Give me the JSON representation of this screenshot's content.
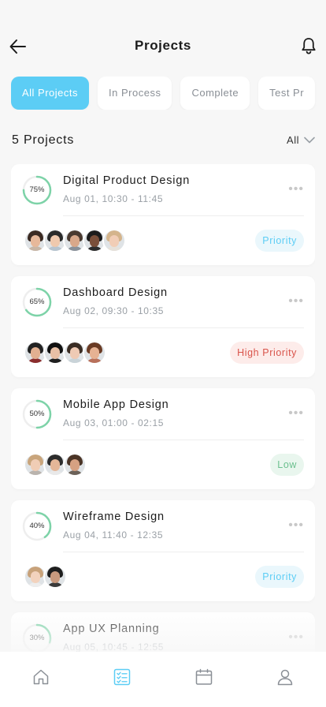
{
  "header": {
    "title": "Projects"
  },
  "tabs": [
    {
      "label": "All Projects",
      "active": true
    },
    {
      "label": "In Process",
      "active": false
    },
    {
      "label": "Complete",
      "active": false
    },
    {
      "label": "Test Pr",
      "active": false
    }
  ],
  "summary": {
    "count_label": "5 Projects",
    "filter_label": "All"
  },
  "colors": {
    "accent": "#5ccdf5",
    "progress": "#7dd3a8",
    "track": "#eeeeee"
  },
  "projects": [
    {
      "title": "Digital Product Design",
      "time": "Aug 01, 10:30 - 11:45",
      "progress_label": "75%",
      "progress": 0.75,
      "priority": "Priority",
      "priority_style": "priority",
      "avatars": [
        {
          "hair": "#3b2a22",
          "skin": "#e7b89a",
          "shirt": "#c8b6a6"
        },
        {
          "hair": "#2a2a2a",
          "skin": "#efc9ae",
          "shirt": "#b7c4cf"
        },
        {
          "hair": "#4a3a30",
          "skin": "#d9a88a",
          "shirt": "#8a9199"
        },
        {
          "hair": "#1c1c1c",
          "skin": "#7a4f3a",
          "shirt": "#2d2d2d"
        },
        {
          "hair": "#d4b48c",
          "skin": "#f1cdb6",
          "shirt": "#e6e1da"
        }
      ]
    },
    {
      "title": "Dashboard Design",
      "time": "Aug 02, 09:30 - 10:35",
      "progress_label": "65%",
      "progress": 0.65,
      "priority": "High Priority",
      "priority_style": "high",
      "avatars": [
        {
          "hair": "#222222",
          "skin": "#e2b091",
          "shirt": "#8a2d2d"
        },
        {
          "hair": "#111111",
          "skin": "#e8c0a6",
          "shirt": "#1f1f1f"
        },
        {
          "hair": "#3a2d24",
          "skin": "#efcab4",
          "shirt": "#c9d3d8"
        },
        {
          "hair": "#6a3b24",
          "skin": "#e6b293",
          "shirt": "#b8705a"
        }
      ]
    },
    {
      "title": "Mobile App Design",
      "time": "Aug 03, 01:00 - 02:15",
      "progress_label": "50%",
      "progress": 0.5,
      "priority": "Low",
      "priority_style": "low",
      "avatars": [
        {
          "hair": "#c9a57c",
          "skin": "#f0cdb5",
          "shirt": "#b9b3ad"
        },
        {
          "hair": "#2c2c2c",
          "skin": "#e4b698",
          "shirt": "#e9e9e9"
        },
        {
          "hair": "#4b3426",
          "skin": "#d6a182",
          "shirt": "#6b6158"
        }
      ]
    },
    {
      "title": "Wireframe Design",
      "time": "Aug 04, 11:40 - 12:35",
      "progress_label": "40%",
      "progress": 0.4,
      "priority": "Priority",
      "priority_style": "priority",
      "avatars": [
        {
          "hair": "#c8a27a",
          "skin": "#f2d2bd",
          "shirt": "#ededed"
        },
        {
          "hair": "#1e1e1e",
          "skin": "#c99a7e",
          "shirt": "#3a3a3a"
        }
      ]
    },
    {
      "title": "App UX Planning",
      "time": "Aug 05, 10:45 - 12:55",
      "progress_label": "30%",
      "progress": 0.3,
      "priority": "",
      "priority_style": "priority",
      "avatars": []
    }
  ],
  "bottom_nav": [
    {
      "icon": "home-icon",
      "active": false
    },
    {
      "icon": "tasks-icon",
      "active": true
    },
    {
      "icon": "calendar-icon",
      "active": false
    },
    {
      "icon": "profile-icon",
      "active": false
    }
  ]
}
